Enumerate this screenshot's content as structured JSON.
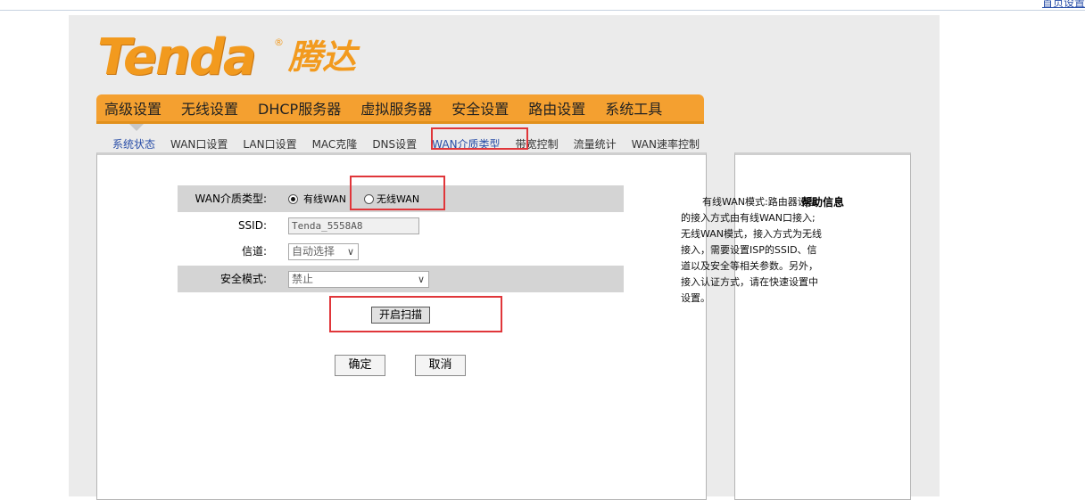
{
  "top_link": "首页设置",
  "logo": {
    "brand": "Tenda",
    "reg": "®",
    "cn": "腾达"
  },
  "main_nav": [
    "高级设置",
    "无线设置",
    "DHCP服务器",
    "虚拟服务器",
    "安全设置",
    "路由设置",
    "系统工具"
  ],
  "sub_nav": [
    "系统状态",
    "WAN口设置",
    "LAN口设置",
    "MAC克隆",
    "DNS设置",
    "WAN介质类型",
    "带宽控制",
    "流量统计",
    "WAN速率控制"
  ],
  "form": {
    "wan_type_label": "WAN介质类型:",
    "wired_option": "有线WAN",
    "wireless_option": "无线WAN",
    "ssid_label": "SSID:",
    "ssid_value": "Tenda_5558A8",
    "channel_label": "信道:",
    "channel_value": "自动选择",
    "security_label": "安全模式:",
    "security_value": "禁止",
    "scan_button": "开启扫描",
    "ok_button": "确定",
    "cancel_button": "取消"
  },
  "help": {
    "title": "帮助信息",
    "body": "有线WAN模式:路由器设备的接入方式由有线WAN口接入;无线WAN模式，接入方式为无线接入，需要设置ISP的SSID、信道以及安全等相关参数。另外，接入认证方式，请在快速设置中设置。"
  },
  "colors": {
    "accent_orange": "#f4a030",
    "highlight_red": "#e0363a",
    "link_blue": "#2a4fa8"
  }
}
